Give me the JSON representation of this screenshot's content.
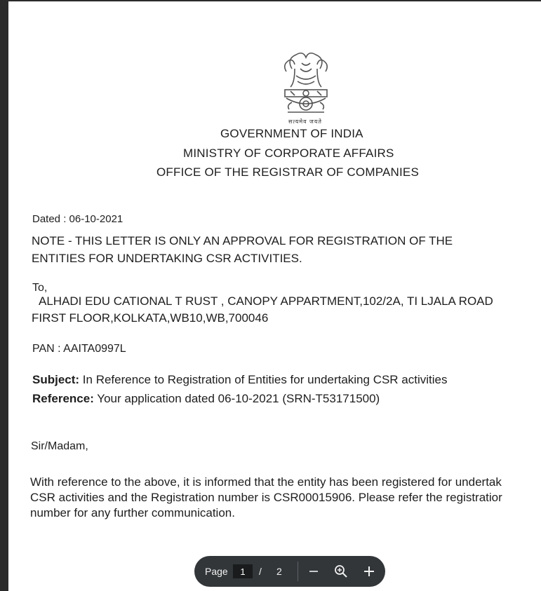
{
  "letter": {
    "motto": "सत्यमेव जयते",
    "header": {
      "line1": "GOVERNMENT OF INDIA",
      "line2": "MINISTRY OF CORPORATE AFFAIRS",
      "line3": "OFFICE OF THE REGISTRAR OF COMPANIES"
    },
    "dated": "Dated : 06-10-2021",
    "note_line1": "NOTE - THIS LETTER IS ONLY AN APPROVAL FOR REGISTRATION OF THE",
    "note_line2": "ENTITIES FOR UNDERTAKING CSR ACTIVITIES.",
    "to": "To,",
    "address_line1": "ALHADI EDU CATIONAL T RUST , CANOPY APPARTMENT,102/2A, TI LJALA ROAD",
    "address_line2": "FIRST FLOOR,KOLKATA,WB10,WB,700046",
    "pan": "PAN : AAITA0997L",
    "subject_label": "Subject:",
    "subject_text": "In Reference to Registration of Entities for undertaking CSR activities",
    "reference_label": "Reference:",
    "reference_text": "Your application dated 06-10-2021 (SRN-T53171500)",
    "salutation": "Sir/Madam,",
    "body_line1": "With reference to the above, it is informed that the entity has been registered for undertak",
    "body_line2": "CSR activities and the Registration number is CSR00015906. Please refer the registratior",
    "body_line3": "number for any further communication."
  },
  "viewer": {
    "page_label": "Page",
    "current_page": "1",
    "separator": "/",
    "total_pages": "2"
  },
  "colors": {
    "toolbar_bg": "#323639",
    "backdrop": "#2b2b2b"
  },
  "icons": [
    "state-emblem-icon",
    "zoom-out-icon",
    "zoom-fit-icon",
    "zoom-in-icon"
  ]
}
